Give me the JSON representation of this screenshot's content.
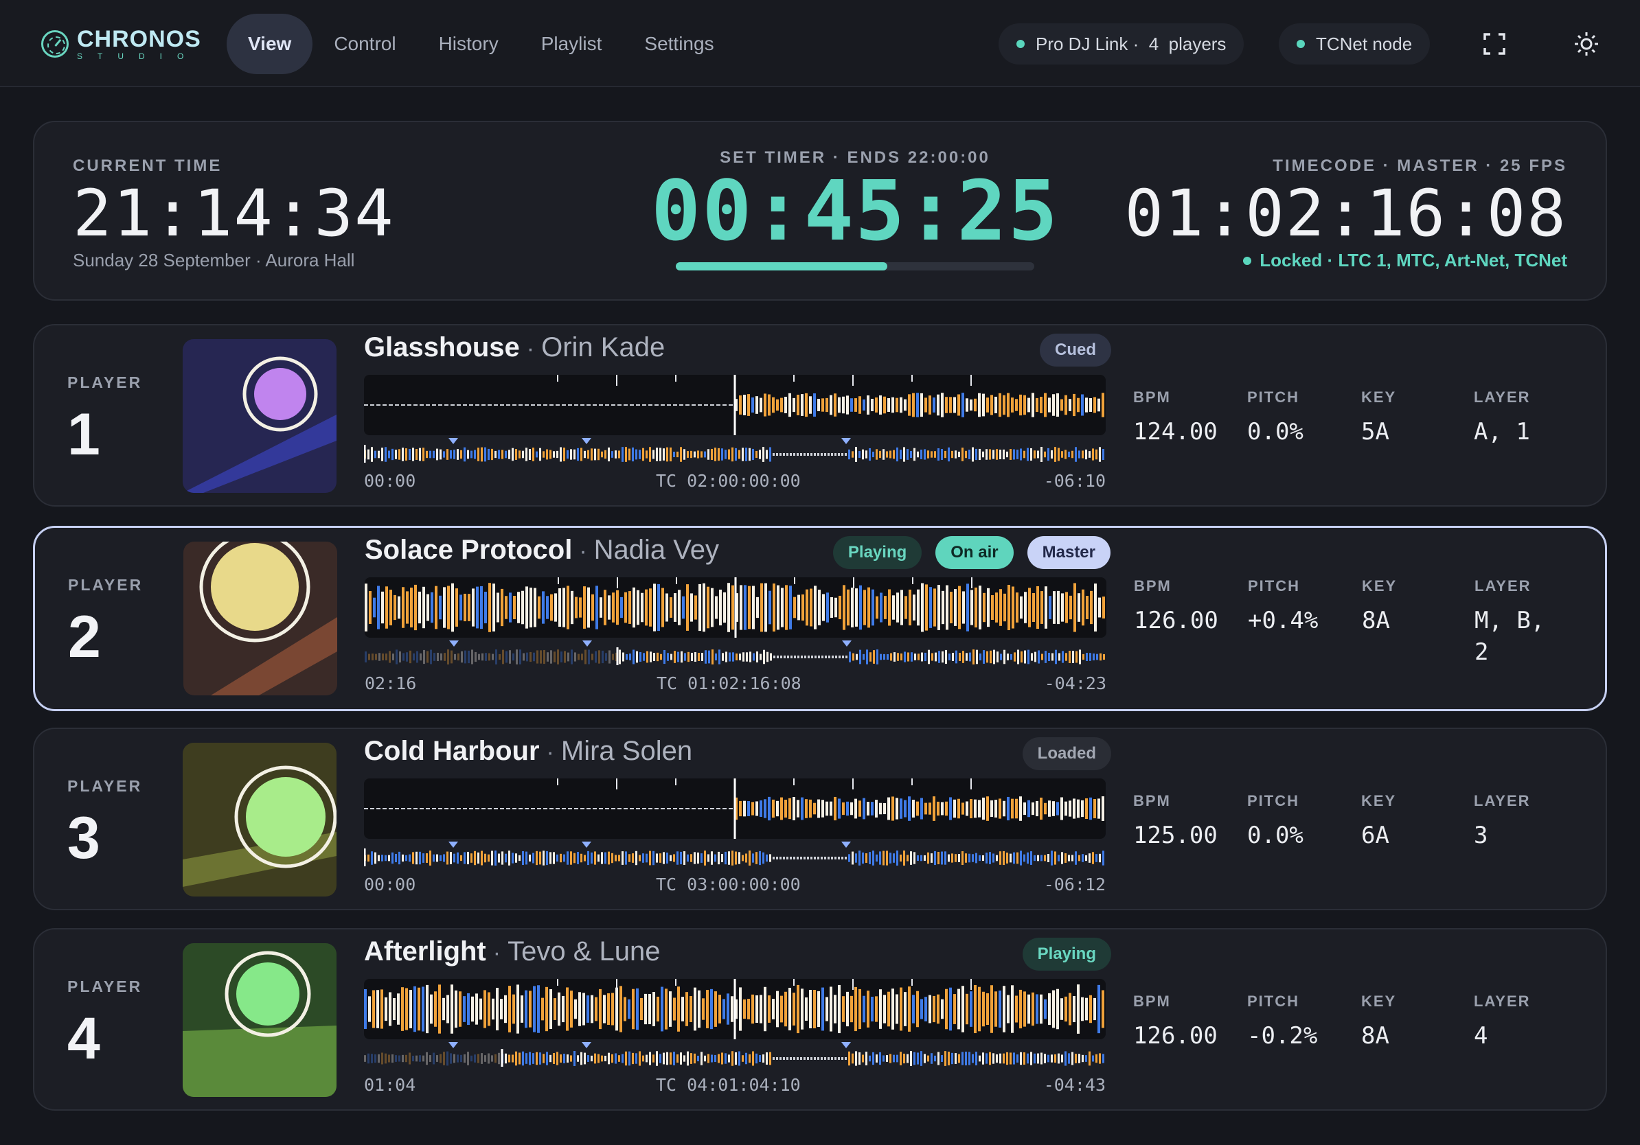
{
  "app": {
    "brand": "CHRONOS",
    "brand_sub": "STUDIO"
  },
  "nav": {
    "tabs": [
      {
        "label": "View",
        "active": true
      },
      {
        "label": "Control"
      },
      {
        "label": "History"
      },
      {
        "label": "Playlist"
      },
      {
        "label": "Settings"
      }
    ]
  },
  "status": {
    "link": "Pro DJ Link ·  4  players",
    "node": "TCNet node",
    "dot_color": "#5ad6bd"
  },
  "icons": {
    "fullscreen": "fullscreen-icon",
    "theme": "sun-icon"
  },
  "clock": {
    "current_caption": "CURRENT TIME",
    "current_time": "21:14:34",
    "current_sub": "Sunday 28 September · Aurora Hall",
    "timer_caption": "SET TIMER · ENDS 22:00:00",
    "timer": "00:45:25",
    "timer_progress": 0.59,
    "tc_caption": "TIMECODE · MASTER · 25 FPS",
    "tc": "01:02:16:08",
    "tc_status": "Locked · LTC 1, MTC, Art-Net, TCNet",
    "accent": "#5fd6c0"
  },
  "stat_labels": {
    "bpm": "BPM",
    "pitch": "PITCH",
    "key": "KEY",
    "layer": "LAYER"
  },
  "players": [
    {
      "label": "PLAYER",
      "number": "1",
      "title": "Glasshouse",
      "artist": "Orin Kade",
      "badges": [
        {
          "text": "Cued",
          "style": "cued"
        }
      ],
      "elapsed": "00:00",
      "tc": "TC 02:00:00:00",
      "remaining": "-06:10",
      "bpm": "124.00",
      "pitch": "0.0%",
      "key": "5A",
      "layer": "A, 1",
      "playhead": 0.5,
      "overview_pos": 0.0,
      "active": false,
      "art": {
        "bg": "#262652",
        "band": "#33399a",
        "disc": "#c084ee"
      }
    },
    {
      "label": "PLAYER",
      "number": "2",
      "title": "Solace Protocol",
      "artist": "Nadia Vey",
      "badges": [
        {
          "text": "Playing",
          "style": "playing"
        },
        {
          "text": "On air",
          "style": "onair"
        },
        {
          "text": "Master",
          "style": "master"
        }
      ],
      "elapsed": "02:16",
      "tc": "TC 01:02:16:08",
      "remaining": "-04:23",
      "bpm": "126.00",
      "pitch": "+0.4%",
      "key": "8A",
      "layer": "M, B, 2",
      "playhead": 0.5,
      "overview_pos": 0.34,
      "active": true,
      "art": {
        "bg": "#3a2a27",
        "band": "#7a4733",
        "disc": "#e8d98a"
      }
    },
    {
      "label": "PLAYER",
      "number": "3",
      "title": "Cold Harbour",
      "artist": "Mira Solen",
      "badges": [
        {
          "text": "Loaded",
          "style": "loaded"
        }
      ],
      "elapsed": "00:00",
      "tc": "TC 03:00:00:00",
      "remaining": "-06:12",
      "bpm": "125.00",
      "pitch": "0.0%",
      "key": "6A",
      "layer": "3",
      "playhead": 0.5,
      "overview_pos": 0.0,
      "active": false,
      "art": {
        "bg": "#3e3d1f",
        "band": "#6c7332",
        "disc": "#a8ec8a"
      }
    },
    {
      "label": "PLAYER",
      "number": "4",
      "title": "Afterlight",
      "artist": "Tevo & Lune",
      "badges": [
        {
          "text": "Playing",
          "style": "playing"
        }
      ],
      "elapsed": "01:04",
      "tc": "TC 04:01:04:10",
      "remaining": "-04:43",
      "bpm": "126.00",
      "pitch": "-0.2%",
      "key": "8A",
      "layer": "4",
      "playhead": 0.5,
      "overview_pos": 0.185,
      "active": false,
      "art": {
        "bg": "#2c4a26",
        "band": "#5a8a3a",
        "disc": "#86e889"
      }
    }
  ]
}
